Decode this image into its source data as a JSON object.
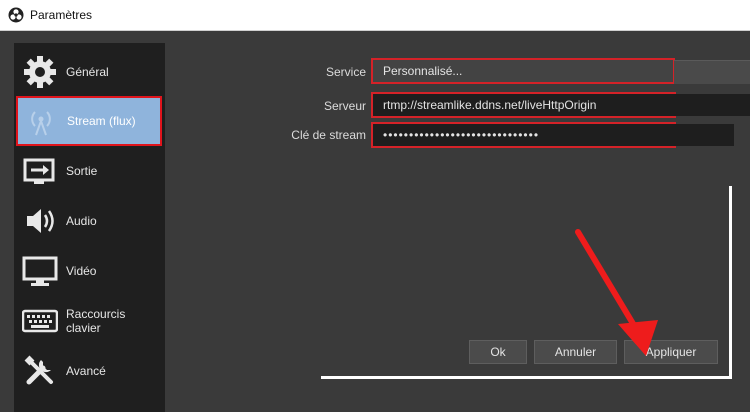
{
  "window": {
    "title": "Paramètres"
  },
  "sidebar": {
    "items": [
      {
        "id": "general",
        "label": "Général",
        "icon": "gear-icon",
        "active": false
      },
      {
        "id": "stream",
        "label": "Stream (flux)",
        "icon": "broadcast-icon",
        "active": true
      },
      {
        "id": "output",
        "label": "Sortie",
        "icon": "output-icon",
        "active": false
      },
      {
        "id": "audio",
        "label": "Audio",
        "icon": "speaker-icon",
        "active": false
      },
      {
        "id": "video",
        "label": "Vidéo",
        "icon": "monitor-icon",
        "active": false
      },
      {
        "id": "hotkeys",
        "label": "Raccourcis clavier",
        "icon": "keyboard-icon",
        "active": false
      },
      {
        "id": "advanced",
        "label": "Avancé",
        "icon": "tools-icon",
        "active": false
      }
    ]
  },
  "form": {
    "service": {
      "label": "Service",
      "value": "Personnalisé..."
    },
    "server": {
      "label": "Serveur",
      "value": "rtmp://streamlike.ddns.net/liveHttpOrigin"
    },
    "stream_key": {
      "label": "Clé de stream",
      "value": "••••••••••••••••••••••••••••••"
    }
  },
  "buttons": {
    "ok": "Ok",
    "cancel": "Annuler",
    "apply": "Appliquer"
  },
  "colors": {
    "highlight": "#d42228",
    "arrow": "#ee1c1c",
    "active_item": "#8fb4dc"
  }
}
